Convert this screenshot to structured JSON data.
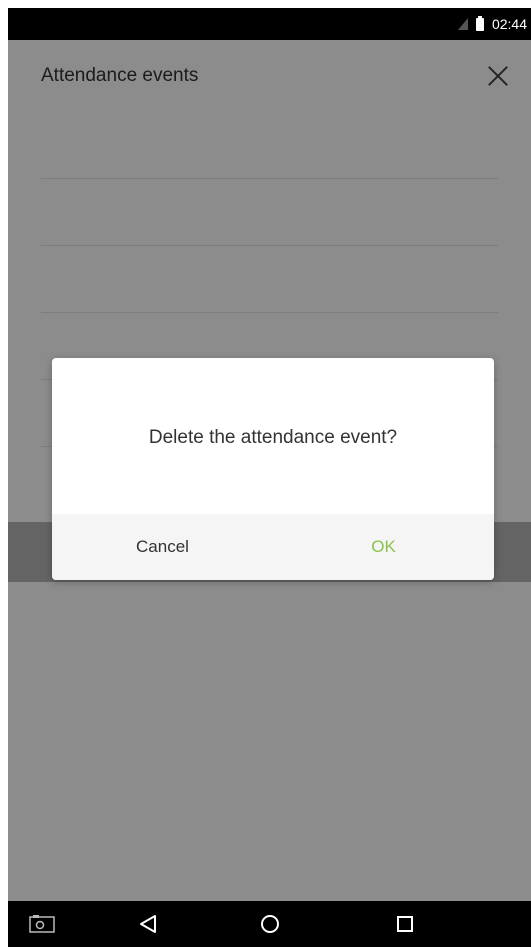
{
  "status_bar": {
    "time": "02:44"
  },
  "app": {
    "title": "Attendance events"
  },
  "dialog": {
    "message": "Delete the attendance event?",
    "cancel_label": "Cancel",
    "ok_label": "OK"
  },
  "nav_bar": {
    "items": [
      "screenshot-icon",
      "back-icon",
      "home-icon",
      "recents-icon"
    ]
  },
  "colors": {
    "ok_accent": "#8bc34a",
    "overlay": "rgba(0,0,0,0.45)"
  }
}
